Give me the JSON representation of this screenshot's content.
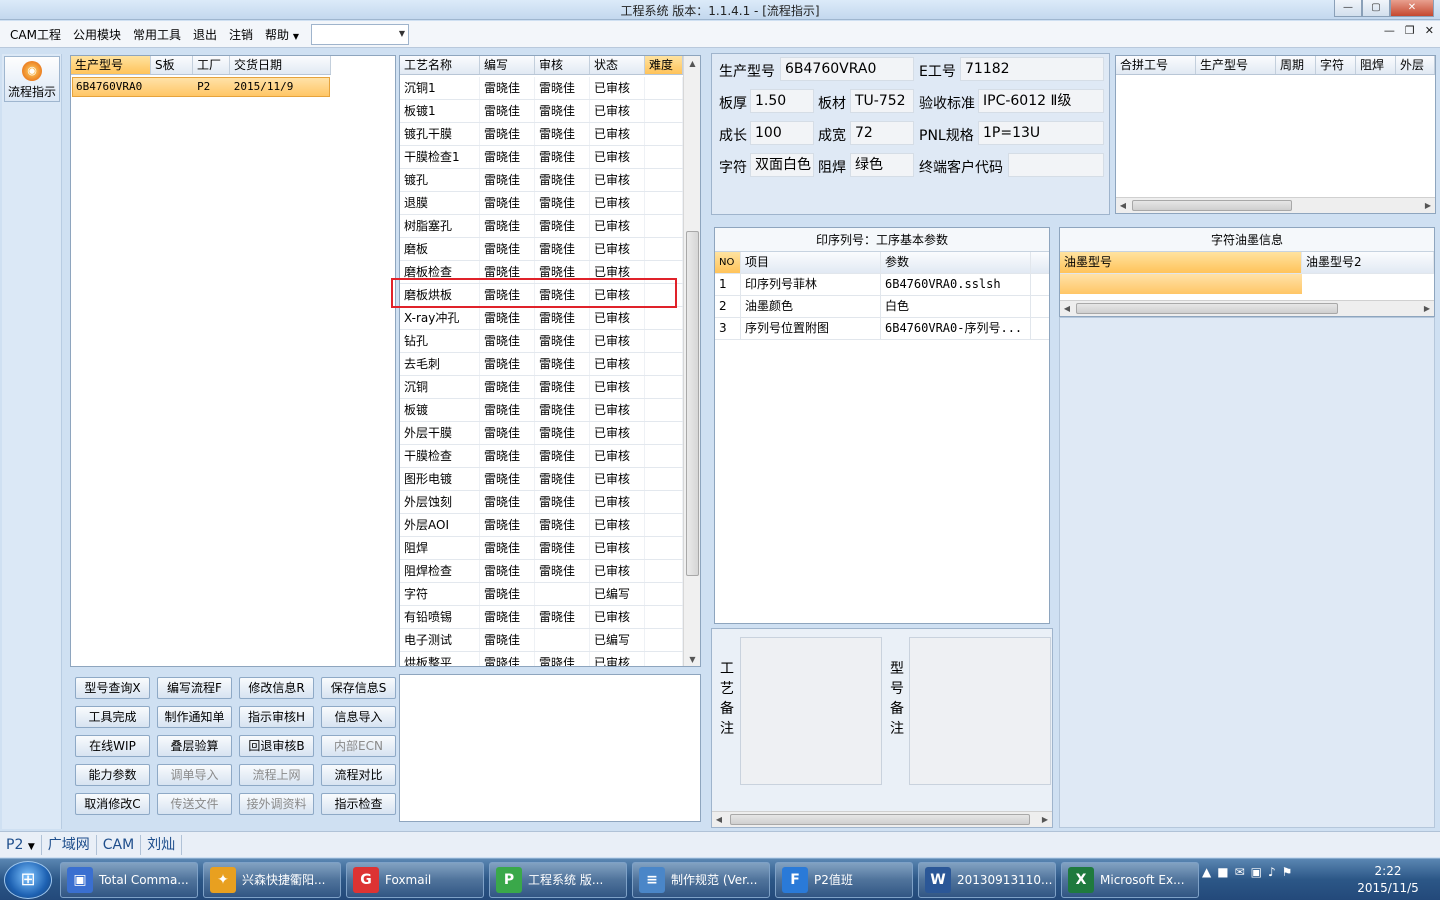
{
  "window": {
    "title": "工程系统   版本：1.1.4.1 - [流程指示]",
    "min": "—",
    "max": "▢",
    "close": "✕"
  },
  "menu": {
    "items": [
      "CAM工程",
      "公用模块",
      "常用工具",
      "退出",
      "注销",
      "帮助"
    ],
    "combo_value": "",
    "mdi_min": "—",
    "mdi_restore": "❐",
    "mdi_close": "✕"
  },
  "leftbar": {
    "flow_button": "流程指示"
  },
  "product_table": {
    "columns": [
      "生产型号",
      "S板",
      "工厂",
      "交货日期"
    ],
    "rows": [
      {
        "model": "6B4760VRA0",
        "s": "",
        "factory": "P2",
        "date": "2015/11/9"
      }
    ]
  },
  "process_table": {
    "columns": [
      "工艺名称",
      "编写",
      "审核",
      "状态",
      "难度"
    ],
    "rows": [
      [
        "沉铜1",
        "雷晓佳",
        "雷晓佳",
        "已审核"
      ],
      [
        "板镀1",
        "雷晓佳",
        "雷晓佳",
        "已审核"
      ],
      [
        "镀孔干膜",
        "雷晓佳",
        "雷晓佳",
        "已审核"
      ],
      [
        "干膜检查1",
        "雷晓佳",
        "雷晓佳",
        "已审核"
      ],
      [
        "镀孔",
        "雷晓佳",
        "雷晓佳",
        "已审核"
      ],
      [
        "退膜",
        "雷晓佳",
        "雷晓佳",
        "已审核"
      ],
      [
        "树脂塞孔",
        "雷晓佳",
        "雷晓佳",
        "已审核"
      ],
      [
        "磨板",
        "雷晓佳",
        "雷晓佳",
        "已审核"
      ],
      [
        "磨板检查",
        "雷晓佳",
        "雷晓佳",
        "已审核"
      ],
      [
        "磨板烘板",
        "雷晓佳",
        "雷晓佳",
        "已审核"
      ],
      [
        "X-ray冲孔",
        "雷晓佳",
        "雷晓佳",
        "已审核"
      ],
      [
        "钻孔",
        "雷晓佳",
        "雷晓佳",
        "已审核"
      ],
      [
        "去毛刺",
        "雷晓佳",
        "雷晓佳",
        "已审核"
      ],
      [
        "沉铜",
        "雷晓佳",
        "雷晓佳",
        "已审核"
      ],
      [
        "板镀",
        "雷晓佳",
        "雷晓佳",
        "已审核"
      ],
      [
        "外层干膜",
        "雷晓佳",
        "雷晓佳",
        "已审核"
      ],
      [
        "干膜检查",
        "雷晓佳",
        "雷晓佳",
        "已审核"
      ],
      [
        "图形电镀",
        "雷晓佳",
        "雷晓佳",
        "已审核"
      ],
      [
        "外层蚀刻",
        "雷晓佳",
        "雷晓佳",
        "已审核"
      ],
      [
        "外层AOI",
        "雷晓佳",
        "雷晓佳",
        "已审核"
      ],
      [
        "阻焊",
        "雷晓佳",
        "雷晓佳",
        "已审核"
      ],
      [
        "阻焊检查",
        "雷晓佳",
        "雷晓佳",
        "已审核"
      ],
      [
        "字符",
        "雷晓佳",
        "",
        "已编写"
      ],
      [
        "有铅喷锡",
        "雷晓佳",
        "雷晓佳",
        "已审核"
      ],
      [
        "电子测试",
        "雷晓佳",
        "",
        "已编写"
      ],
      [
        "烘板整平",
        "雷晓佳",
        "雷晓佳",
        "已审核"
      ]
    ]
  },
  "buttons": [
    [
      "型号查询X",
      "编写流程F",
      "修改信息R",
      "保存信息S"
    ],
    [
      "工具完成",
      "制作通知单",
      "指示审核H",
      "信息导入"
    ],
    [
      "在线WIP",
      "叠层验算",
      "回退审核B",
      "内部ECN"
    ],
    [
      "能力参数",
      "调单导入",
      "流程上网",
      "流程对比"
    ],
    [
      "取消修改C",
      "传送文件",
      "接外调资料",
      "指示检查"
    ]
  ],
  "disabled_buttons": [
    "内部ECN",
    "调单导入",
    "流程上网",
    "传送文件",
    "接外调资料"
  ],
  "info": {
    "model_label": "生产型号",
    "model": "6B4760VRA0",
    "eng_label": "E工号",
    "eng": "71182",
    "thick_label": "板厚",
    "thick": "1.50",
    "mat_label": "板材",
    "mat": "TU-752",
    "std_label": "验收标准",
    "std": "IPC-6012 Ⅱ级",
    "len_label": "成长",
    "len": "100",
    "wid_label": "成宽",
    "wid": "72",
    "pnl_label": "PNL规格",
    "pnl": "1P=13U",
    "char_label": "字符",
    "char": "双面白色",
    "mask_label": "阻焊",
    "mask": "绿色",
    "cust_label": "终端客户代码",
    "cust": ""
  },
  "merge_table": {
    "columns": [
      "合拼工号",
      "生产型号",
      "周期",
      "字符",
      "阻焊",
      "外层"
    ]
  },
  "params": {
    "title": "印序列号：工序基本参数",
    "columns": [
      "NO",
      "项目",
      "参数"
    ],
    "rows": [
      [
        "1",
        "印序列号菲林",
        "6B4760VRA0.sslsh"
      ],
      [
        "2",
        "油墨颜色",
        "白色"
      ],
      [
        "3",
        "序列号位置附图",
        "6B4760VRA0-序列号..."
      ]
    ]
  },
  "ink": {
    "title": "字符油墨信息",
    "columns": [
      "油墨型号",
      "油墨型号2"
    ]
  },
  "memo": {
    "process_label": [
      "工",
      "艺",
      "备",
      "注"
    ],
    "model_label": [
      "型",
      "号",
      "备",
      "注"
    ]
  },
  "status": {
    "factory": "P2",
    "net": "广域网",
    "dept": "CAM",
    "user": "刘灿"
  },
  "taskbar": {
    "tasks": [
      "Total Comma...",
      "兴森快捷衢阳...",
      "Foxmail",
      "工程系统   版...",
      "制作规范 (Ver...",
      "P2值班",
      "20130913110...",
      "Microsoft Ex..."
    ],
    "time": "2:22",
    "date": "2015/11/5"
  },
  "colors": {
    "selected_row": "#ffc666",
    "highlight_box": "#e0222a",
    "panel_bg": "#dfe9f5"
  }
}
